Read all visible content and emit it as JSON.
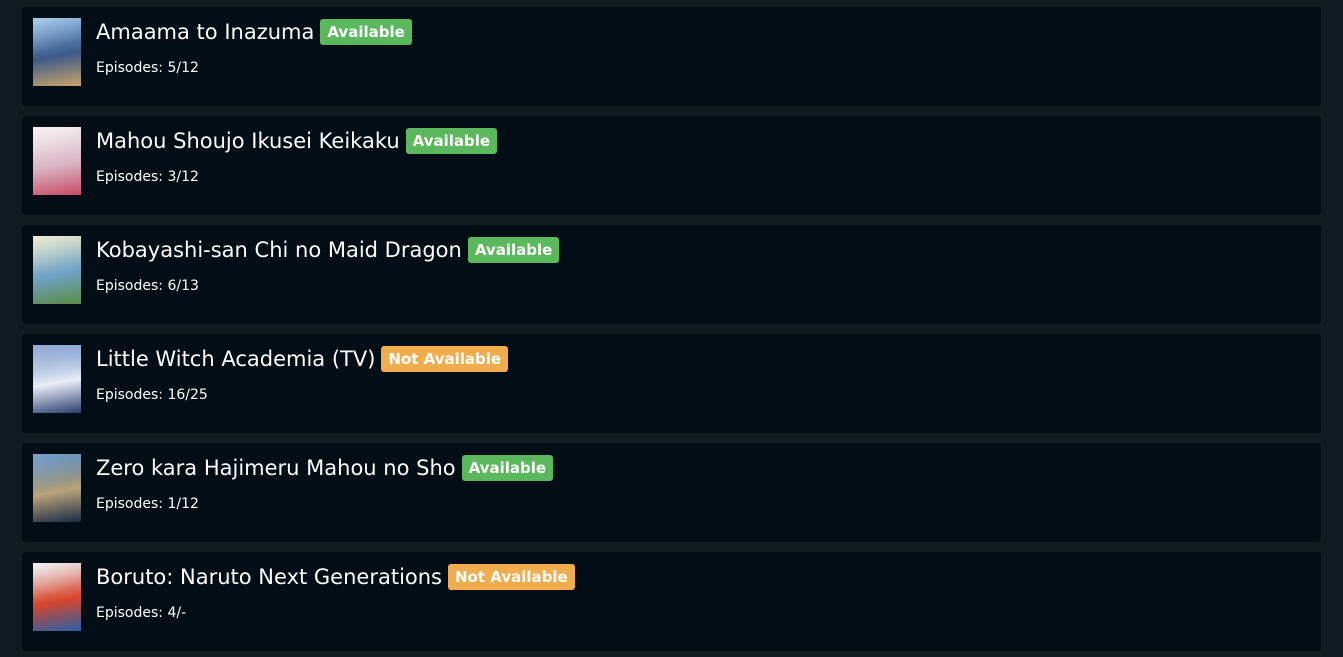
{
  "items": [
    {
      "title": "Amaama to Inazuma",
      "status": "Available",
      "status_kind": "available",
      "episodes": "Episodes: 5/12",
      "cover_icon": "anime-cover-image",
      "cover_colors": [
        "#7fb4e6",
        "#c9a46a",
        "#3d5a8a"
      ]
    },
    {
      "title": "Mahou Shoujo Ikusei Keikaku",
      "status": "Available",
      "status_kind": "available",
      "episodes": "Episodes: 3/12",
      "cover_icon": "anime-cover-image",
      "cover_colors": [
        "#f3ecef",
        "#c94a66",
        "#d9b7c4"
      ]
    },
    {
      "title": "Kobayashi-san Chi no Maid Dragon",
      "status": "Available",
      "status_kind": "available",
      "episodes": "Episodes: 6/13",
      "cover_icon": "anime-cover-image",
      "cover_colors": [
        "#e7e2c0",
        "#5d8a4a",
        "#6fa3c8"
      ]
    },
    {
      "title": "Little Witch Academia (TV)",
      "status": "Not Available",
      "status_kind": "not-available",
      "episodes": "Episodes: 16/25",
      "cover_icon": "anime-cover-image",
      "cover_colors": [
        "#5a7fc0",
        "#2a3c70",
        "#e8eef6"
      ]
    },
    {
      "title": "Zero kara Hajimeru Mahou no Sho",
      "status": "Available",
      "status_kind": "available",
      "episodes": "Episodes: 1/12",
      "cover_icon": "anime-cover-image",
      "cover_colors": [
        "#2e6fb5",
        "#1a2a44",
        "#b9a37a"
      ]
    },
    {
      "title": "Boruto: Naruto Next Generations",
      "status": "Not Available",
      "status_kind": "not-available",
      "episodes": "Episodes: 4/-",
      "cover_icon": "anime-cover-image",
      "cover_colors": [
        "#e9eef4",
        "#2c5fa8",
        "#d8452b"
      ]
    }
  ],
  "colors": {
    "background": "#101c22",
    "card": "#020d15",
    "available": "#5cb85c",
    "not_available": "#f0ad4e",
    "text": "#ffffff"
  }
}
